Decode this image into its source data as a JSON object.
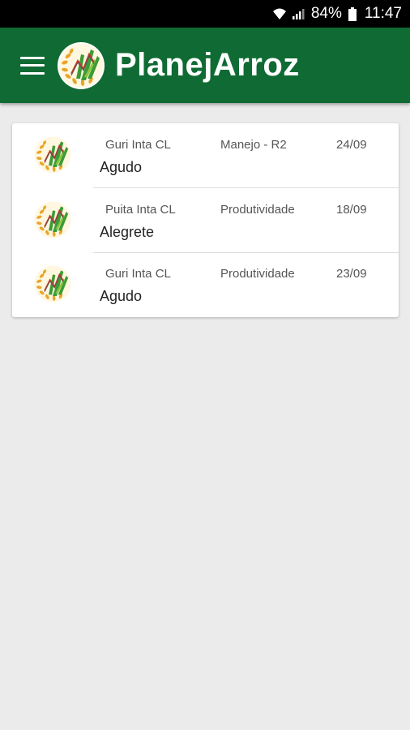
{
  "status_bar": {
    "battery_pct": "84%",
    "time": "11:47",
    "icons": [
      "wifi-icon",
      "signal-icon",
      "battery-icon"
    ]
  },
  "app_bar": {
    "title": "PlanejArroz",
    "menu_icon": "hamburger-menu-icon",
    "logo_icon": "planejarroz-logo-icon",
    "color": "#0f6b33"
  },
  "list": {
    "items": [
      {
        "variety": "Guri Inta CL",
        "type": "Manejo - R2",
        "date": "24/09",
        "city": "Agudo"
      },
      {
        "variety": "Puita Inta CL",
        "type": "Produtividade",
        "date": "18/09",
        "city": "Alegrete"
      },
      {
        "variety": "Guri Inta CL",
        "type": "Produtividade",
        "date": "23/09",
        "city": "Agudo"
      }
    ]
  }
}
